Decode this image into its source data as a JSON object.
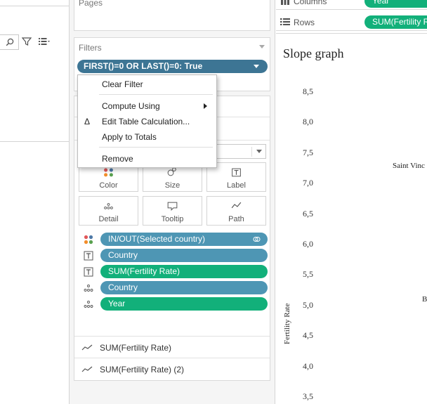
{
  "pages": {
    "title": "Pages"
  },
  "filters": {
    "title": "Filters",
    "pill_label": "FIRST()=0 OR LAST()=0: True"
  },
  "context_menu": {
    "items": [
      {
        "label": "Clear Filter"
      },
      {
        "label": "Compute Using",
        "has_submenu": true
      },
      {
        "label": "Edit Table Calculation...",
        "icon": "delta-icon"
      },
      {
        "label": "Apply to Totals"
      },
      {
        "label": "Remove"
      }
    ]
  },
  "marks": {
    "buttons": [
      {
        "label": "Color",
        "icon": "color-dots-icon"
      },
      {
        "label": "Size",
        "icon": "size-circles-icon"
      },
      {
        "label": "Label",
        "icon": "label-t-icon"
      },
      {
        "label": "Detail",
        "icon": "detail-dots-icon"
      },
      {
        "label": "Tooltip",
        "icon": "tooltip-bubble-icon"
      },
      {
        "label": "Path",
        "icon": "path-line-icon"
      }
    ],
    "fields": [
      {
        "label": "IN/OUT(Selected country)",
        "color": "#4e96b4",
        "icon": "color-dots-icon"
      },
      {
        "label": "Country",
        "color": "#4e96b4",
        "icon": "label-t-icon"
      },
      {
        "label": "SUM(Fertility Rate)",
        "color": "#12b07a",
        "icon": "label-t-icon"
      },
      {
        "label": "Country",
        "color": "#4e96b4",
        "icon": "detail-dots-icon"
      },
      {
        "label": "Year",
        "color": "#12b07a",
        "icon": "detail-dots-icon"
      }
    ],
    "series": [
      {
        "label": "SUM(Fertility Rate)"
      },
      {
        "label": "SUM(Fertility Rate) (2)"
      }
    ]
  },
  "shelves": {
    "columns": {
      "label": "Columns",
      "pill": "Year"
    },
    "rows": {
      "label": "Rows",
      "pill": "SUM(Fertility Rate)"
    }
  },
  "view": {
    "title": "Slope graph",
    "y_axis_title": "Fertility Rate",
    "y_ticks": [
      "8,5",
      "8,0",
      "7,5",
      "7,0",
      "6,5",
      "6,0",
      "5,5",
      "5,0",
      "4,5",
      "4,0",
      "3,5"
    ],
    "mark_labels": [
      "Saint Vinc",
      "B"
    ]
  },
  "colors": {
    "filter_pill": "#3d7594",
    "dimension_pill": "#4e96b4",
    "measure_pill": "#12b07a"
  }
}
